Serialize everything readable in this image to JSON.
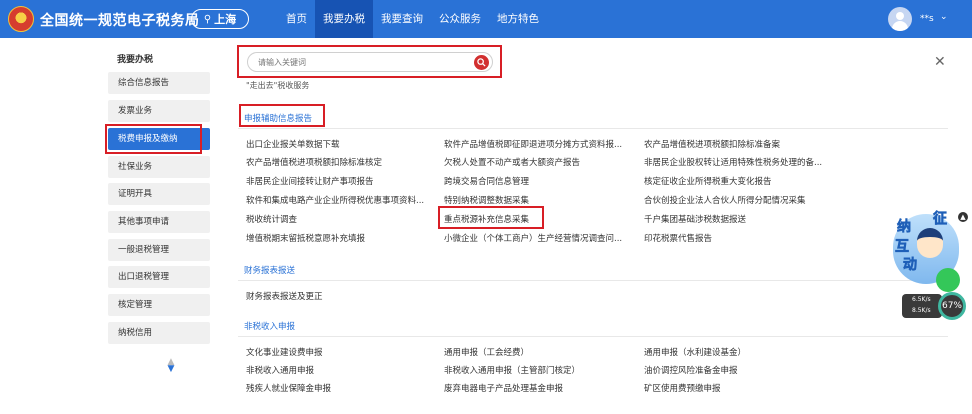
{
  "header": {
    "title": "全国统一规范电子税务局",
    "region": "上海",
    "nav": [
      "首页",
      "我要办税",
      "我要查询",
      "公众服务",
      "地方特色"
    ],
    "active_nav": "我要办税",
    "user_name": "**s"
  },
  "sidebar": {
    "title": "我要办税",
    "items": [
      "综合信息报告",
      "发票业务",
      "税费申报及缴纳",
      "社保业务",
      "证明开具",
      "其他事项申请",
      "一般退税管理",
      "出口退税管理",
      "核定管理",
      "纳税信用"
    ],
    "active_item": "税费申报及缴纳"
  },
  "search": {
    "placeholder": "请输入关键词"
  },
  "hint": "\"走出去\"税收服务",
  "sections": [
    {
      "title": "申报辅助信息报告",
      "items": [
        "出口企业报关单数据下载",
        "软件产品增值税即征即退进项分摊方式资料报...",
        "农产品增值税进项税额扣除标准备案",
        "农产品增值税进项税额扣除标准核定",
        "欠税人处置不动产或者大额资产报告",
        "非居民企业股权转让适用特殊性税务处理的备...",
        "非居民企业间接转让财产事项报告",
        "跨境交易合同信息管理",
        "核定征收企业所得税重大变化报告",
        "软件和集成电路产业企业所得税优惠事项资料...",
        "特别纳税调整数据采集",
        "合伙创投企业法人合伙人所得分配情况采集",
        "税收统计调查",
        "重点税源补充信息采集",
        "千户集团基础涉税数据报送",
        "增值税期末留抵税意愿补充填报",
        "小微企业（个体工商户）生产经营情况调查问...",
        "印花税票代售报告"
      ]
    },
    {
      "title": "财务报表报送",
      "items": [
        "财务报表报送及更正"
      ]
    },
    {
      "title": "非税收入申报",
      "items": [
        "文化事业建设费申报",
        "通用申报（工会经费）",
        "通用申报（水利建设基金）",
        "非税收入通用申报",
        "非税收入通用申报（主管部门核定）",
        "油价调控风险准备金申报",
        "残疾人就业保障金申报",
        "废弃电器电子产品处理基金申报",
        "矿区使用费预缴申报"
      ]
    }
  ],
  "widget": {
    "chars": [
      "纳",
      "征",
      "互",
      "动"
    ],
    "speed_up": "6.5K/s",
    "speed_down": "8.5K/s",
    "percent": "67%"
  },
  "icons": {
    "search": "search-icon",
    "close": "close-icon",
    "location": "location-pin-icon",
    "chevron": "chevron-down-icon"
  },
  "colors": {
    "header": "#2a72d6",
    "active_nav": "#1753b3",
    "highlight_box": "#d81e25",
    "section_title": "#2a72d6"
  }
}
